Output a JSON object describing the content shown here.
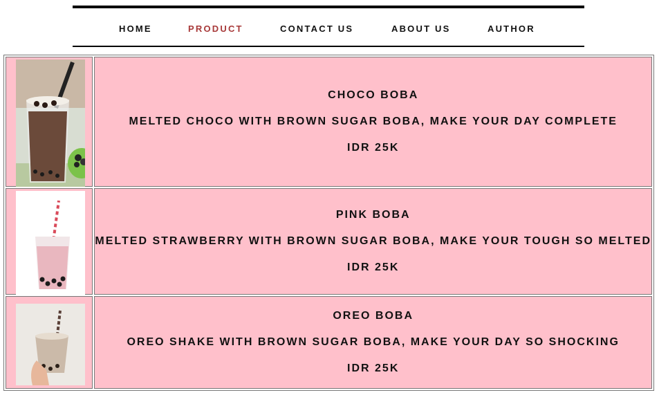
{
  "nav": {
    "items": [
      {
        "label": "HOME"
      },
      {
        "label": "PRODUCT"
      },
      {
        "label": "CONTACT US"
      },
      {
        "label": "ABOUT US"
      },
      {
        "label": "AUTHOR"
      }
    ],
    "active_color": "#a83a3a"
  },
  "products": [
    {
      "name": "CHOCO BOBA",
      "description": "MELTED CHOCO WITH BROWN SUGAR BOBA, MAKE YOUR DAY COMPLETE",
      "price": "IDR 25K"
    },
    {
      "name": "PINK BOBA",
      "description": "MELTED STRAWBERRY WITH BROWN SUGAR BOBA, MAKE YOUR TOUGH SO MELTED",
      "price": "IDR 25K"
    },
    {
      "name": "OREO BOBA",
      "description": "OREO SHAKE WITH BROWN SUGAR BOBA, MAKE YOUR DAY SO SHOCKING",
      "price": "IDR 25K"
    }
  ],
  "colors": {
    "row_background": "#ffc0cb"
  }
}
